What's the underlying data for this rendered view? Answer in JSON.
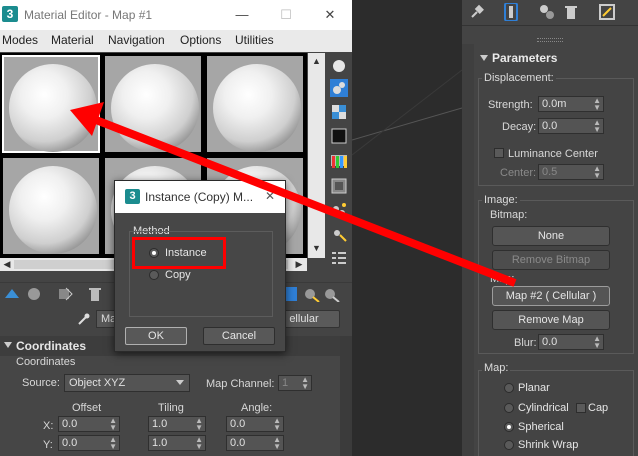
{
  "material_editor": {
    "title": "Material Editor - Map #1",
    "window_buttons": [
      "—",
      "☐",
      "✕"
    ],
    "menu": [
      "Modes",
      "Material",
      "Navigation",
      "Options",
      "Utilities"
    ],
    "material_name": "Ma",
    "material_type": "ellular",
    "coordinates": {
      "rollout_title": "Coordinates",
      "group_title": "Coordinates",
      "source_label": "Source:",
      "source_value": "Object XYZ",
      "map_channel_label": "Map Channel:",
      "map_channel_value": "1",
      "col_offset": "Offset",
      "col_tiling": "Tiling",
      "col_angle": "Angle:",
      "rows": [
        {
          "axis": "X:",
          "offset": "0.0",
          "tiling": "1.0",
          "angle": "0.0"
        },
        {
          "axis": "Y:",
          "offset": "0.0",
          "tiling": "1.0",
          "angle": "0.0"
        }
      ]
    }
  },
  "dialog": {
    "title": "Instance (Copy) M...",
    "close": "✕",
    "method_label": "Method",
    "options": [
      {
        "label": "Instance",
        "selected": true
      },
      {
        "label": "Copy",
        "selected": false
      }
    ],
    "ok_label": "OK",
    "cancel_label": "Cancel"
  },
  "panel": {
    "parameters_title": "Parameters",
    "displacement": {
      "group_title": "Displacement:",
      "strength_label": "Strength:",
      "strength_value": "0.0m",
      "decay_label": "Decay:",
      "decay_value": "0.0",
      "luminance_center_label": "Luminance Center",
      "center_label": "Center:",
      "center_value": "0.5"
    },
    "image": {
      "group_title": "Image:",
      "bitmap_label": "Bitmap:",
      "bitmap_button": "None",
      "remove_bitmap_button": "Remove Bitmap",
      "map_label": "Map:",
      "map_button": "Map #2  ( Cellular )",
      "remove_map_button": "Remove Map",
      "blur_label": "Blur:",
      "blur_value": "0.0"
    },
    "map": {
      "group_title": "Map:",
      "options": [
        {
          "label": "Planar",
          "selected": false
        },
        {
          "label": "Cylindrical",
          "selected": false
        },
        {
          "label": "Spherical",
          "selected": true
        },
        {
          "label": "Shrink Wrap",
          "selected": false
        }
      ],
      "cap_label": "Cap"
    }
  },
  "colors": {
    "annotation_red": "#ff0000",
    "app_icon_teal": "#1b8c8f",
    "active_tool_blue": "#2f7fd6"
  },
  "icons": [
    "pin-icon",
    "modifier-stack-icon",
    "make-unique-icon",
    "trash-icon",
    "configure-icon",
    "eyedropper-icon",
    "sample-type-icon",
    "backlight-icon",
    "background-icon",
    "video-color-check-icon",
    "get-material-icon",
    "assign-material-icon",
    "reset-map-icon",
    "show-map-icon",
    "go-parent-icon"
  ]
}
